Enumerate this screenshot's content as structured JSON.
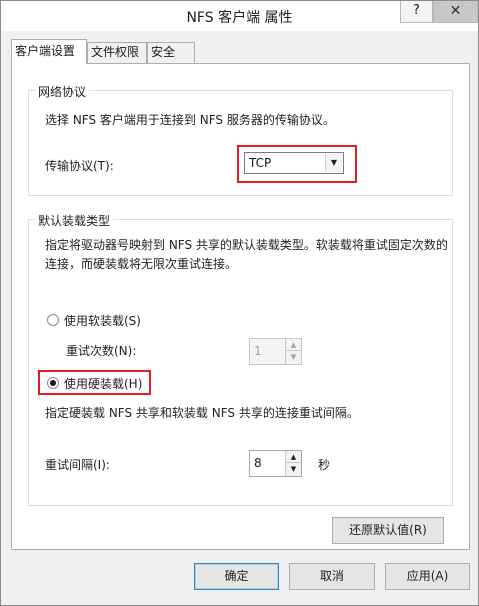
{
  "window": {
    "title": "NFS 客户端 属性"
  },
  "titlebar": {
    "help_glyph": "?",
    "close_glyph": "✕"
  },
  "tabs": [
    {
      "label": "客户端设置",
      "active": true
    },
    {
      "label": "文件权限",
      "active": false
    },
    {
      "label": "安全",
      "active": false
    }
  ],
  "protocol_group": {
    "legend": "网络协议",
    "description": "选择 NFS 客户端用于连接到 NFS 服务器的传输协议。",
    "transport_label": "传输协议(T):",
    "transport_value": "TCP"
  },
  "mount_group": {
    "legend": "默认装载类型",
    "description": "指定将驱动器号映射到 NFS 共享的默认装载类型。软装载将重试固定次数的连接，而硬装载将无限次重试连接。",
    "soft_label": "使用软装载(S)",
    "retry_label": "重试次数(N):",
    "retry_value": "1",
    "hard_label": "使用硬装载(H)",
    "hard_description": "指定硬装载 NFS 共享和软装载 NFS 共享的连接重试间隔。",
    "interval_label": "重试间隔(I):",
    "interval_value": "8",
    "interval_unit": "秒",
    "selected": "hard"
  },
  "restore_defaults_label": "还原默认值(R)",
  "footer": {
    "ok_label": "确定",
    "cancel_label": "取消",
    "apply_label": "应用(A)"
  },
  "colors": {
    "highlight": "#e81b22",
    "primary_border": "#3c7fb1"
  }
}
